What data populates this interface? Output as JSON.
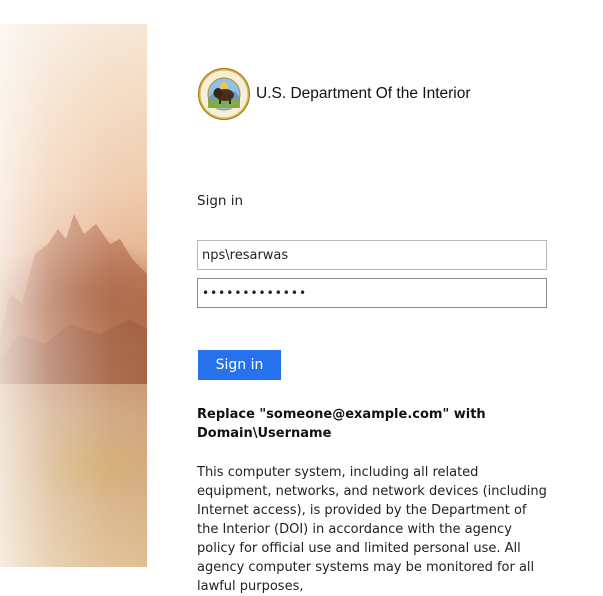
{
  "header": {
    "org_name": "U.S. Department Of the Interior",
    "seal_top_text": "U.S. DEPARTMENT OF THE INTERIOR",
    "seal_bottom_text": "MARCH 3, 1849"
  },
  "signin": {
    "title": "Sign in",
    "username_value": "nps\\resarwas",
    "password_value": "•••••••••••••",
    "button_label": "Sign in"
  },
  "note": {
    "text": "Replace \"someone@example.com\" with Domain\\Username"
  },
  "disclaimer": {
    "text": "This computer system, including all related equipment, networks, and network devices (including Internet access), is provided by the Department of the Interior (DOI) in accordance with the agency policy for official use and limited personal use. All agency computer systems may be monitored for all lawful purposes,"
  },
  "colors": {
    "button": "#2672ec",
    "button_text": "#ffffff"
  }
}
